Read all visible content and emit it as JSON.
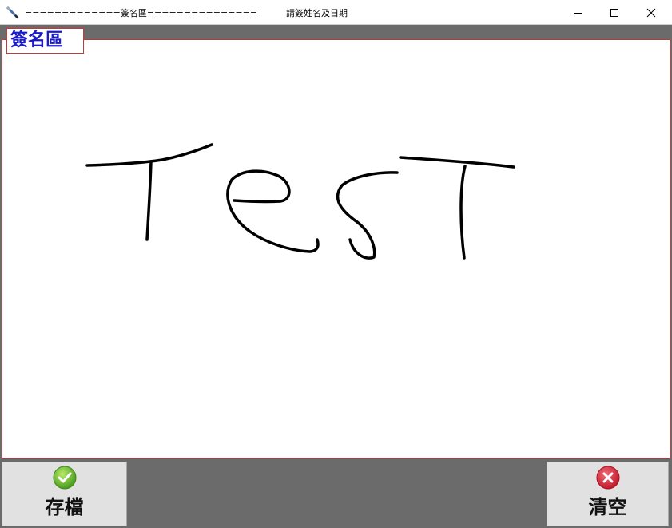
{
  "window": {
    "title_left": "=============簽名區===============",
    "title_right": "請簽姓名及日期",
    "app_icon": "pen-icon",
    "minimize_icon": "minimize-icon",
    "maximize_icon": "maximize-icon",
    "close_icon": "close-icon"
  },
  "signature": {
    "label": "簽名區",
    "label_color": "#1a1ac8",
    "border_color": "#b23a3a",
    "ink_color": "#000000"
  },
  "actions": {
    "save": {
      "label": "存檔",
      "icon": "check-circle-icon",
      "color": "#5fb52a"
    },
    "clear": {
      "label": "清空",
      "icon": "close-circle-icon",
      "color": "#d32b3b"
    }
  }
}
